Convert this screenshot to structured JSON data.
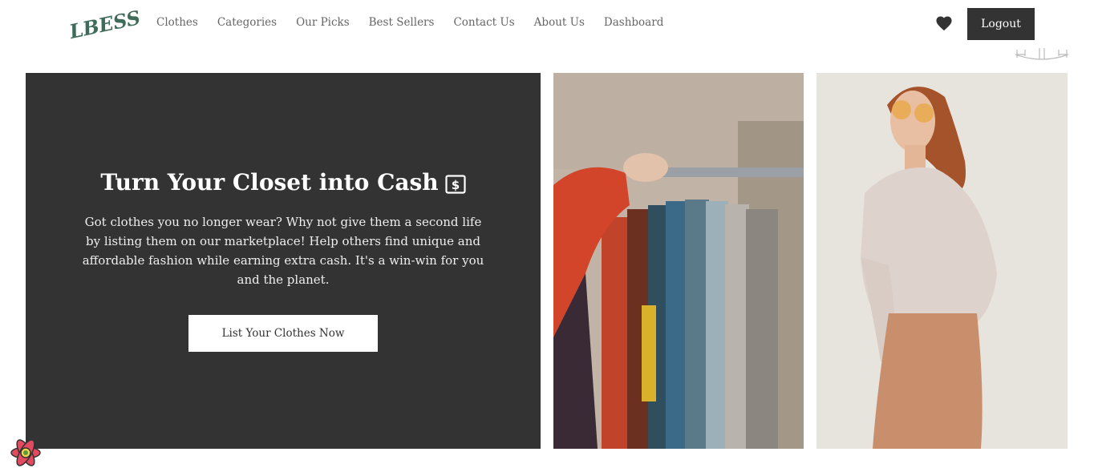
{
  "brand": {
    "logo_text": "LBESS",
    "accent": "#3f6b5a"
  },
  "nav": {
    "items": [
      {
        "label": "Clothes"
      },
      {
        "label": "Categories"
      },
      {
        "label": "Our Picks"
      },
      {
        "label": "Best Sellers"
      },
      {
        "label": "Contact Us"
      },
      {
        "label": "About Us"
      },
      {
        "label": "Dashboard"
      }
    ]
  },
  "header": {
    "wishlist_icon": "heart-icon",
    "logout_label": "Logout"
  },
  "hero": {
    "title": "Turn Your Closet into Cash",
    "title_icon": "dollar-square-icon",
    "description": "Got clothes you no longer wear? Why not give them a second life by listing them on our marketplace! Help others find unique and affordable fashion while earning extra cash. It's a win-win for you and the planet.",
    "cta_label": "List Your Clothes Now",
    "background": "#333333"
  },
  "images": [
    {
      "name": "clothing-rack-photo"
    },
    {
      "name": "model-photo"
    }
  ],
  "colors": {
    "dark": "#333333",
    "nav_text": "#666666"
  }
}
